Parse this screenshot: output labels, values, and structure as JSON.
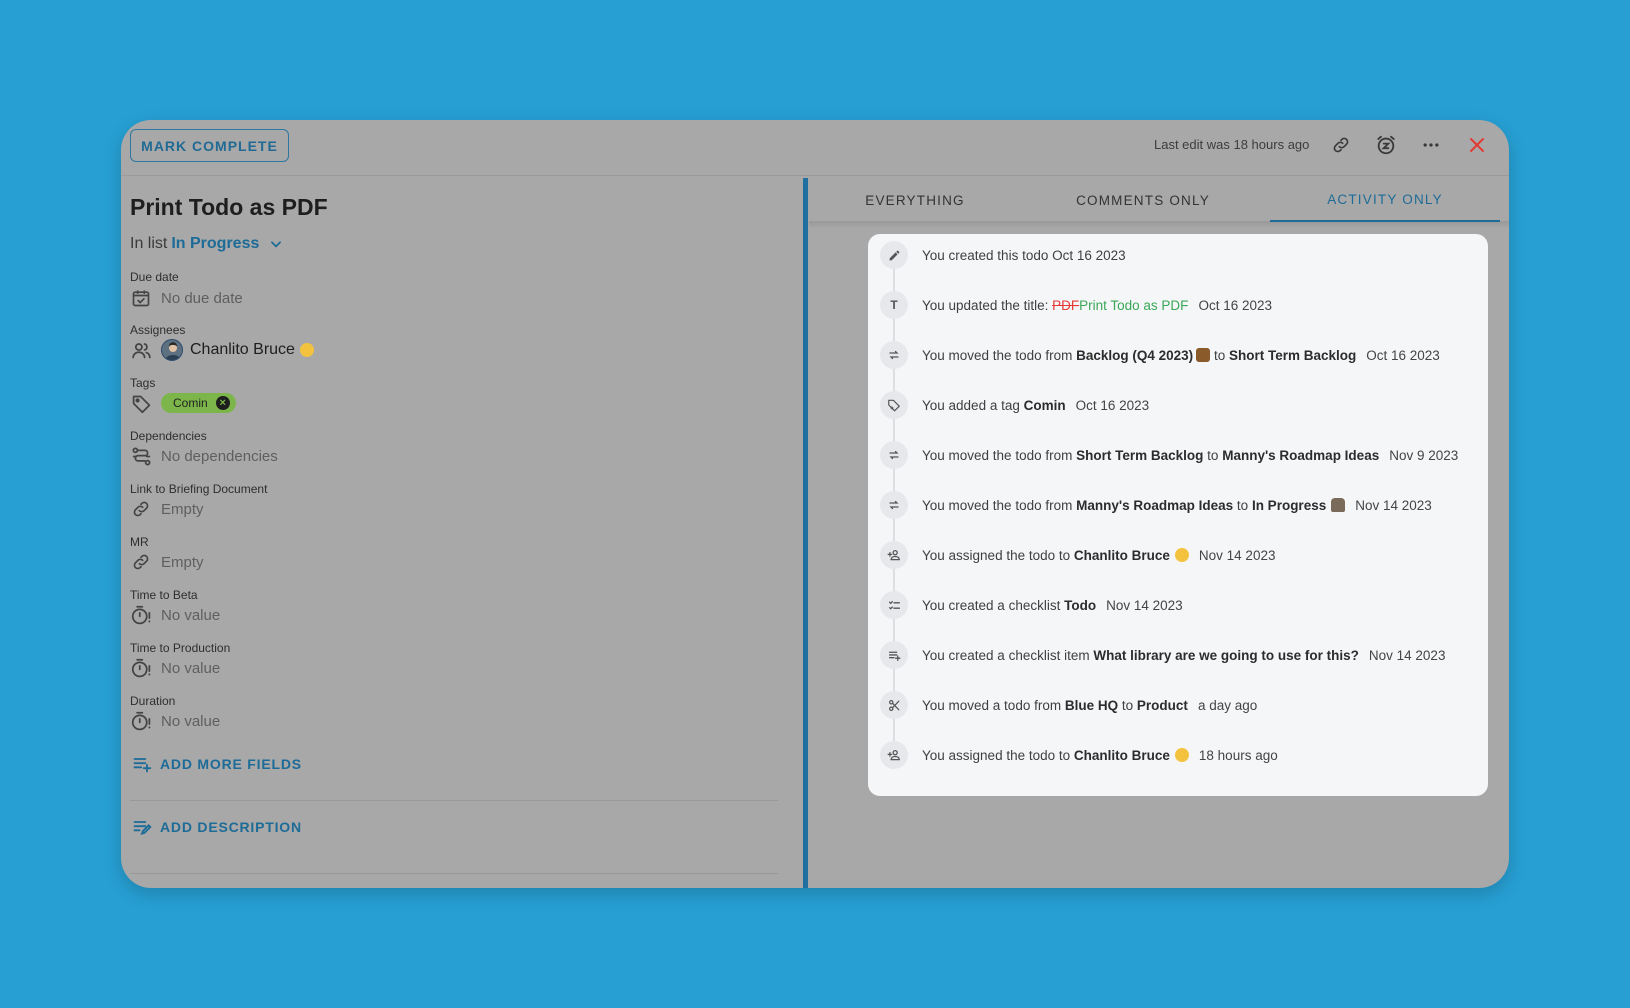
{
  "header": {
    "mark_complete": "MARK COMPLETE",
    "last_edit": "Last edit was 18 hours ago",
    "icons": [
      "link-icon",
      "snooze-alarm-icon",
      "more-icon",
      "close-icon"
    ],
    "close_color": "#e53935"
  },
  "todo": {
    "title": "Print Todo as PDF",
    "in_list_prefix": "In list",
    "list_name": "In Progress"
  },
  "fields": {
    "due_date": {
      "label": "Due date",
      "value": "No due date"
    },
    "assignees": {
      "label": "Assignees",
      "value": "Chanlito Bruce"
    },
    "tags": {
      "label": "Tags",
      "value": "Comin",
      "color": "#7cb64a"
    },
    "dependencies": {
      "label": "Dependencies",
      "value": "No dependencies"
    },
    "briefing": {
      "label": "Link to Briefing Document",
      "value": "Empty"
    },
    "mr": {
      "label": "MR",
      "value": "Empty"
    },
    "time_to_beta": {
      "label": "Time to Beta",
      "value": "No value"
    },
    "time_to_production": {
      "label": "Time to Production",
      "value": "No value"
    },
    "duration": {
      "label": "Duration",
      "value": "No value"
    }
  },
  "actions": {
    "add_more_fields": "ADD MORE FIELDS",
    "add_description": "ADD DESCRIPTION"
  },
  "tabs": [
    {
      "label": "EVERYTHING",
      "active": false
    },
    {
      "label": "COMMENTS ONLY",
      "active": false
    },
    {
      "label": "ACTIVITY ONLY",
      "active": true
    }
  ],
  "activity": [
    {
      "icon": "pencil-icon",
      "t1": "You created this todo",
      "date": "Oct 16 2023"
    },
    {
      "icon": "title-icon",
      "t1": "You updated the title:",
      "old": "PDF",
      "new": "Print Todo as PDF",
      "date": "Oct 16 2023"
    },
    {
      "icon": "move-icon",
      "t1": "You moved the todo from",
      "b1": "Backlog (Q4 2023)",
      "t2": "to",
      "b2": "Short Term Backlog",
      "date": "Oct 16 2023"
    },
    {
      "icon": "tag-add-icon",
      "t1": "You added a tag",
      "b1": "Comin",
      "date": "Oct 16 2023"
    },
    {
      "icon": "move-icon",
      "t1": "You moved the todo from",
      "b1": "Short Term Backlog",
      "t2": "to",
      "b2": "Manny's Roadmap Ideas",
      "date": "Nov 9 2023"
    },
    {
      "icon": "move-icon",
      "t1": "You moved the todo from",
      "b1": "Manny's Roadmap Ideas",
      "t2": "to",
      "b2": "In Progress",
      "date": "Nov 14 2023"
    },
    {
      "icon": "person-add-icon",
      "t1": "You assigned the todo to",
      "b1": "Chanlito Bruce",
      "date": "Nov 14 2023"
    },
    {
      "icon": "checklist-icon",
      "t1": "You created a checklist",
      "b1": "Todo",
      "date": "Nov 14 2023"
    },
    {
      "icon": "playlist-add-icon",
      "t1": "You created a checklist item",
      "b1": "What library are we going to use for this?",
      "date": "Nov 14 2023"
    },
    {
      "icon": "scissors-icon",
      "t1": "You moved a todo from",
      "b1": "Blue HQ",
      "t2": "to",
      "b2": "Product",
      "date": "a day ago"
    },
    {
      "icon": "person-add-icon",
      "t1": "You assigned the todo to",
      "b1": "Chanlito Bruce",
      "date": "18 hours ago"
    }
  ]
}
